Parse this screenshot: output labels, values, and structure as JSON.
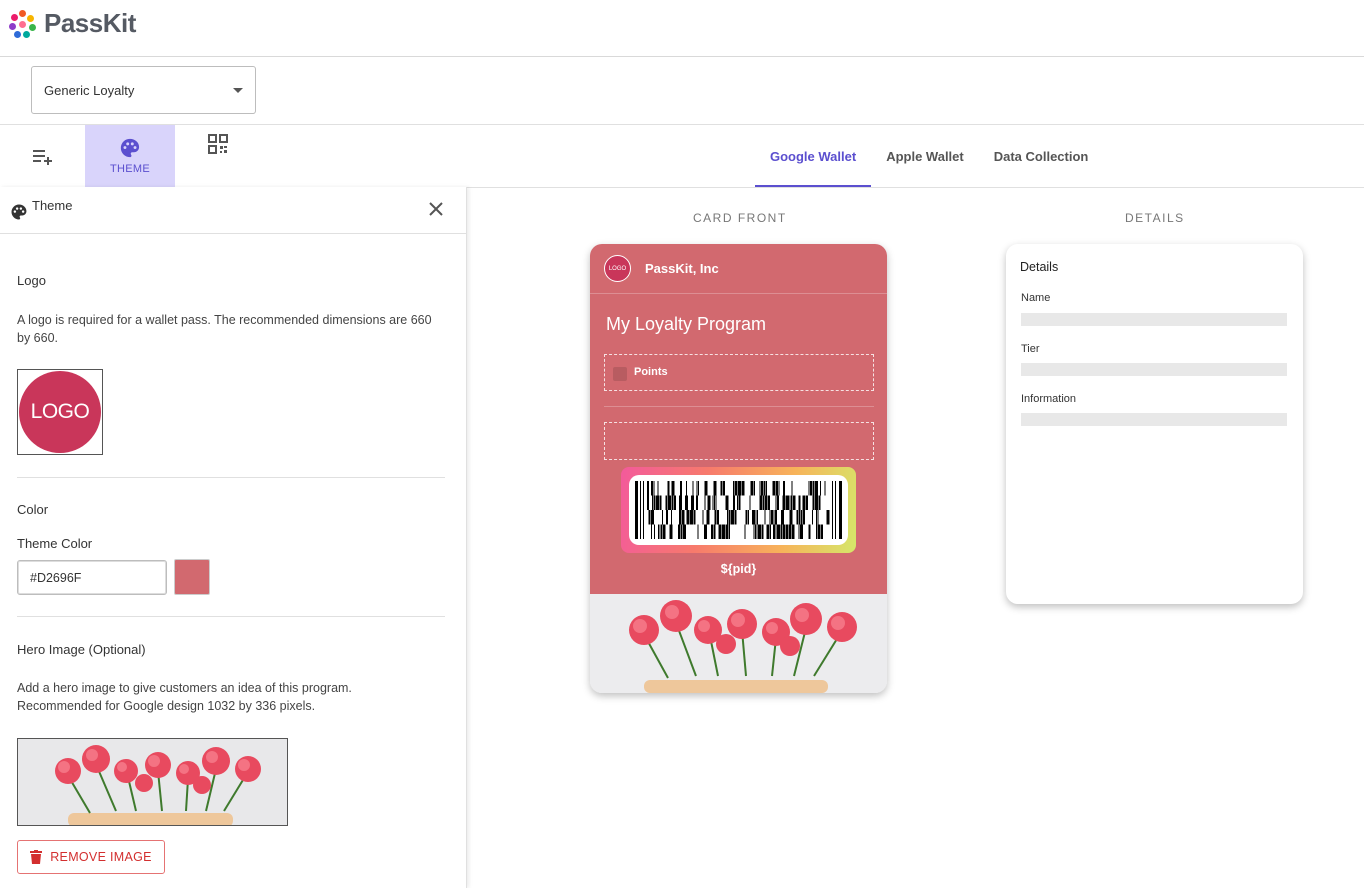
{
  "app": {
    "name": "PassKit"
  },
  "program_select": {
    "value": "Generic Loyalty"
  },
  "tool_tabs": [
    {
      "icon": "playlist-add-icon",
      "label": ""
    },
    {
      "icon": "palette-icon",
      "label": "THEME"
    },
    {
      "icon": "qr-code-icon",
      "label": ""
    }
  ],
  "preview_tabs": [
    {
      "label": "Google Wallet",
      "active": true
    },
    {
      "label": "Apple Wallet",
      "active": false
    },
    {
      "label": "Data Collection",
      "active": false
    }
  ],
  "panel": {
    "title": "Theme",
    "logo": {
      "title": "Logo",
      "description": "A logo is required for a wallet pass. The recommended dimensions are 660 by 660.",
      "image_text": "LOGO"
    },
    "color": {
      "title": "Color",
      "theme_label": "Theme Color",
      "value": "#D2696F"
    },
    "hero": {
      "title": "Hero Image (Optional)",
      "description": "Add a hero image to give customers an idea of this program. Recommended for Google design 1032 by 336 pixels.",
      "remove_label": "REMOVE IMAGE"
    }
  },
  "preview": {
    "front_label": "CARD FRONT",
    "details_label": "DETAILS",
    "card": {
      "logo_text": "LOGO",
      "issuer": "PassKit, Inc",
      "program_name": "My Loyalty Program",
      "points_label": "Points",
      "pid": "${pid}",
      "color": "#D2696F"
    },
    "details": {
      "title": "Details",
      "fields": [
        "Name",
        "Tier",
        "Information"
      ]
    }
  },
  "colors": {
    "accent": "#5B4FCF",
    "theme": "#D2696F",
    "danger": "#D32F2F"
  }
}
